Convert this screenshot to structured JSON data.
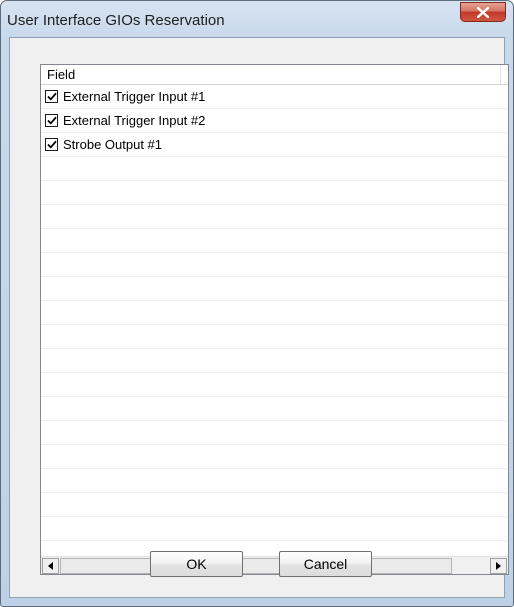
{
  "window": {
    "title": "User Interface GIOs Reservation"
  },
  "list": {
    "column_header": "Field",
    "items": [
      {
        "label": "External Trigger Input #1",
        "checked": true
      },
      {
        "label": "External Trigger Input #2",
        "checked": true
      },
      {
        "label": "Strobe Output #1",
        "checked": true
      }
    ]
  },
  "buttons": {
    "ok_label": "OK",
    "cancel_label": "Cancel"
  },
  "colors": {
    "close_button": "#c0392b",
    "title_bar": "#c9d9ec"
  }
}
